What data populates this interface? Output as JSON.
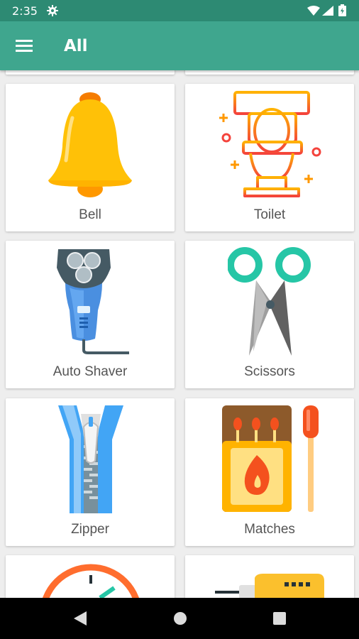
{
  "status_bar": {
    "time": "2:35",
    "icons": [
      "gear-icon",
      "wifi-icon",
      "signal-icon",
      "battery-icon"
    ]
  },
  "app_bar": {
    "title": "All",
    "menu_icon": "hamburger-menu-icon"
  },
  "cards": [
    {
      "label": "Bell",
      "icon": "bell-icon"
    },
    {
      "label": "Toilet",
      "icon": "toilet-icon"
    },
    {
      "label": "Auto Shaver",
      "icon": "electric-shaver-icon"
    },
    {
      "label": "Scissors",
      "icon": "scissors-icon"
    },
    {
      "label": "Zipper",
      "icon": "zipper-icon"
    },
    {
      "label": "Matches",
      "icon": "matchbox-icon"
    }
  ],
  "nav_bar": {
    "buttons": [
      "back-icon",
      "home-icon",
      "recents-icon"
    ]
  },
  "colors": {
    "status_bar": "#2d8a73",
    "app_bar": "#3fa68e"
  }
}
